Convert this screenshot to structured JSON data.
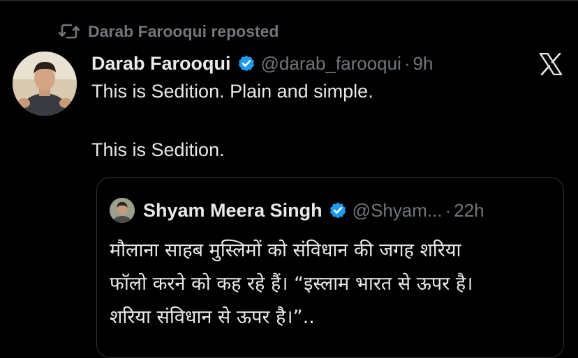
{
  "repost": {
    "icon": "repost-icon",
    "text": "Darab Farooqui reposted"
  },
  "tweet": {
    "author_name": "Darab Farooqui",
    "verified_icon": "verified-badge-icon",
    "handle": "@darab_farooqui",
    "separator": "·",
    "time": "9h",
    "lines": [
      "This is Sedition. Plain and simple.",
      "This is Sedition."
    ]
  },
  "quote": {
    "author_name": "Shyam Meera Singh",
    "handle": "@Shyam...",
    "separator": "·",
    "time": "22h",
    "lines": [
      "मौलाना साहब मुस्लिमों को संविधान की जगह शरिया",
      "फॉलो करने को कह रहे हैं। “इस्लाम भारत से ऊपर है।",
      "शरिया संविधान से ऊपर है।”.."
    ]
  },
  "colors": {
    "background": "#000000",
    "text_primary": "#e7e9ea",
    "text_secondary": "#71767b",
    "verified": "#1d9bf0",
    "border": "#2f3336"
  }
}
